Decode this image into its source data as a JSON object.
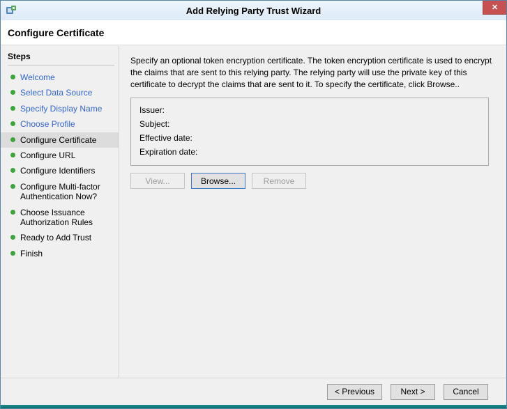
{
  "window": {
    "title": "Add Relying Party Trust Wizard",
    "icons": {
      "close_glyph": "✕"
    },
    "colors": {
      "titlebar_bg": "#ddeaf7",
      "window_border": "#5584a5",
      "close_red": "#c75050",
      "link_blue": "#3366cc",
      "step_dot_green": "#3aa63a",
      "current_step_bg": "#dcdcdc",
      "focus_border_blue": "#3a76c4",
      "bottom_edge_teal": "#117d7d"
    }
  },
  "header": {
    "title": "Configure Certificate"
  },
  "sidebar": {
    "title": "Steps",
    "items": [
      {
        "label": "Welcome",
        "state": "link"
      },
      {
        "label": "Select Data Source",
        "state": "link"
      },
      {
        "label": "Specify Display Name",
        "state": "link"
      },
      {
        "label": "Choose Profile",
        "state": "link"
      },
      {
        "label": "Configure Certificate",
        "state": "current"
      },
      {
        "label": "Configure URL",
        "state": "pending"
      },
      {
        "label": "Configure Identifiers",
        "state": "pending"
      },
      {
        "label": "Configure Multi-factor Authentication Now?",
        "state": "pending"
      },
      {
        "label": "Choose Issuance Authorization Rules",
        "state": "pending"
      },
      {
        "label": "Ready to Add Trust",
        "state": "pending"
      },
      {
        "label": "Finish",
        "state": "pending"
      }
    ]
  },
  "main": {
    "description": "Specify an optional token encryption certificate.  The token encryption certificate is used to encrypt the claims that are sent to this relying party.  The relying party will use the private key of this certificate to decrypt the claims that are sent to it.  To specify the certificate, click Browse..",
    "certificate_panel": {
      "fields": [
        "Issuer:",
        "Subject:",
        "Effective date:",
        "Expiration date:"
      ]
    },
    "buttons": {
      "view": "View...",
      "browse": "Browse...",
      "remove": "Remove"
    }
  },
  "footer": {
    "previous": "< Previous",
    "next": "Next >",
    "cancel": "Cancel"
  }
}
